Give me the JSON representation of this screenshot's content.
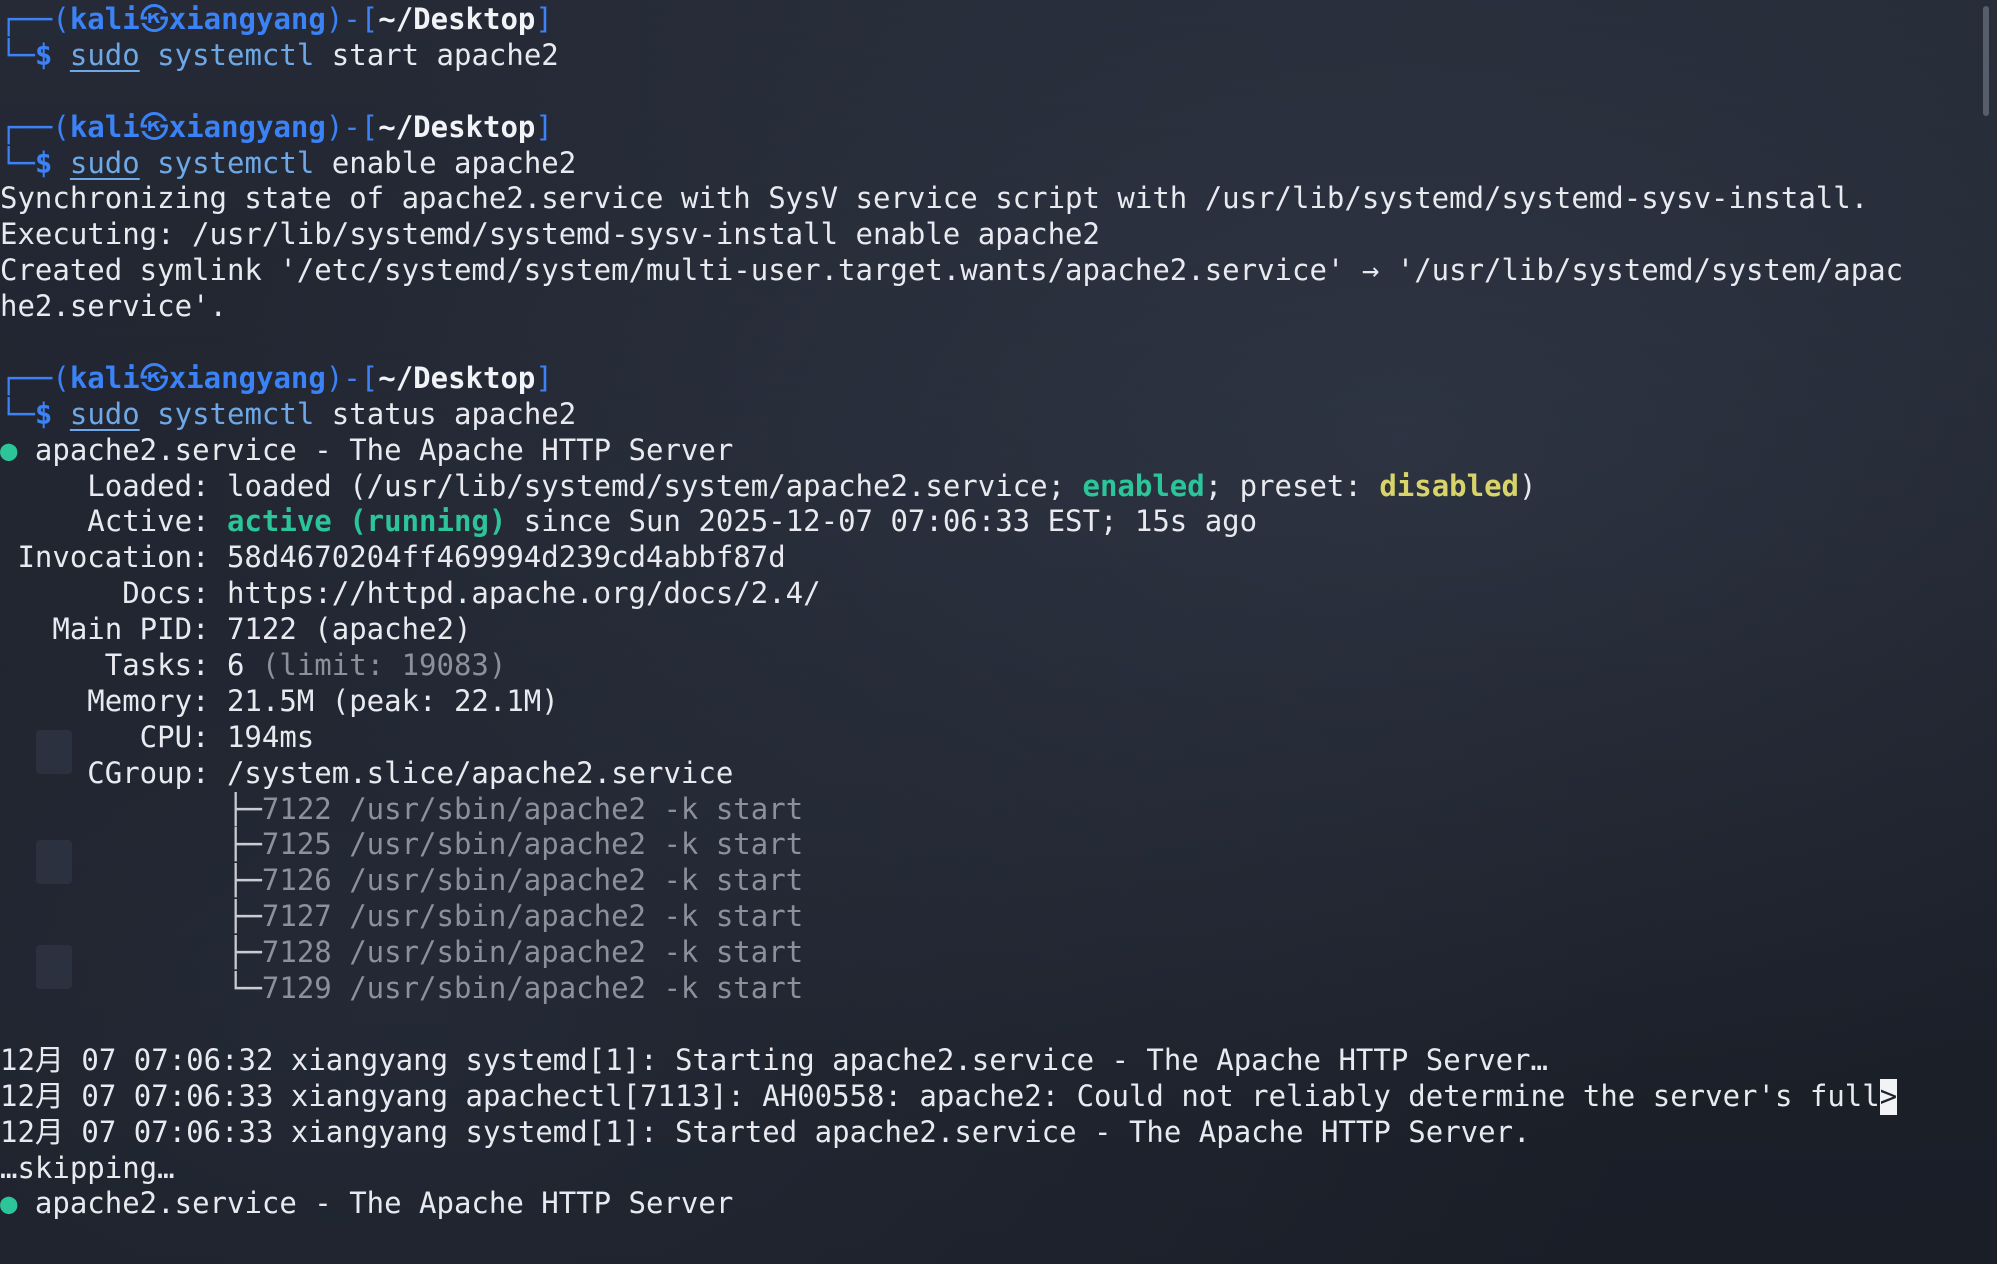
{
  "prompt": {
    "open": "┌──(",
    "user": "kali",
    "at": "㉿",
    "host": "xiangyang",
    "mid": ")-[",
    "path": "~/Desktop",
    "close": "]",
    "corner": "└─",
    "dollar": "$"
  },
  "commands": [
    {
      "sudo": "sudo",
      "cmd": "systemctl",
      "args": " start apache2"
    },
    {
      "sudo": "sudo",
      "cmd": "systemctl",
      "args": " enable apache2"
    },
    {
      "sudo": "sudo",
      "cmd": "systemctl",
      "args": " status apache2"
    }
  ],
  "enable_output": [
    "Synchronizing state of apache2.service with SysV service script with /usr/lib/systemd/systemd-sysv-install.",
    "Executing: /usr/lib/systemd/systemd-sysv-install enable apache2",
    "Created symlink '/etc/systemd/system/multi-user.target.wants/apache2.service' → '/usr/lib/systemd/system/apac",
    "he2.service'."
  ],
  "status": {
    "bullet": "●",
    "header": " apache2.service - The Apache HTTP Server",
    "loaded_label": "     Loaded: ",
    "loaded_value_a": "loaded (/usr/lib/systemd/system/apache2.service; ",
    "loaded_enabled": "enabled",
    "loaded_value_b": "; preset: ",
    "loaded_preset": "disabled",
    "loaded_value_c": ")",
    "active_label": "     Active: ",
    "active_state": "active (running)",
    "active_since": " since Sun 2025-12-07 07:06:33 EST; 15s ago",
    "invocation": " Invocation: 58d4670204ff469994d239cd4abbf87d",
    "docs": "       Docs: https://httpd.apache.org/docs/2.4/",
    "main_pid": "   Main PID: 7122 (apache2)",
    "tasks_label": "      Tasks: 6 ",
    "tasks_limit": "(limit: 19083)",
    "memory": "     Memory: 21.5M (peak: 22.1M)",
    "cpu": "        CPU: 194ms",
    "cgroup": "     CGroup: /system.slice/apache2.service",
    "indent": "             ",
    "processes": [
      {
        "branch": "├─",
        "text": "7122 /usr/sbin/apache2 -k start"
      },
      {
        "branch": "├─",
        "text": "7125 /usr/sbin/apache2 -k start"
      },
      {
        "branch": "├─",
        "text": "7126 /usr/sbin/apache2 -k start"
      },
      {
        "branch": "├─",
        "text": "7127 /usr/sbin/apache2 -k start"
      },
      {
        "branch": "├─",
        "text": "7128 /usr/sbin/apache2 -k start"
      },
      {
        "branch": "└─",
        "text": "7129 /usr/sbin/apache2 -k start"
      }
    ]
  },
  "journal": [
    "12月 07 07:06:32 xiangyang systemd[1]: Starting apache2.service - The Apache HTTP Server…",
    "12月 07 07:06:33 xiangyang apachectl[7113]: AH00558: apache2: Could not reliably determine the server's full",
    "12月 07 07:06:33 xiangyang systemd[1]: Started apache2.service - The Apache HTTP Server."
  ],
  "truncation_marker": ">",
  "skipping": "…skipping…",
  "repeat_header": " apache2.service - The Apache HTTP Server"
}
